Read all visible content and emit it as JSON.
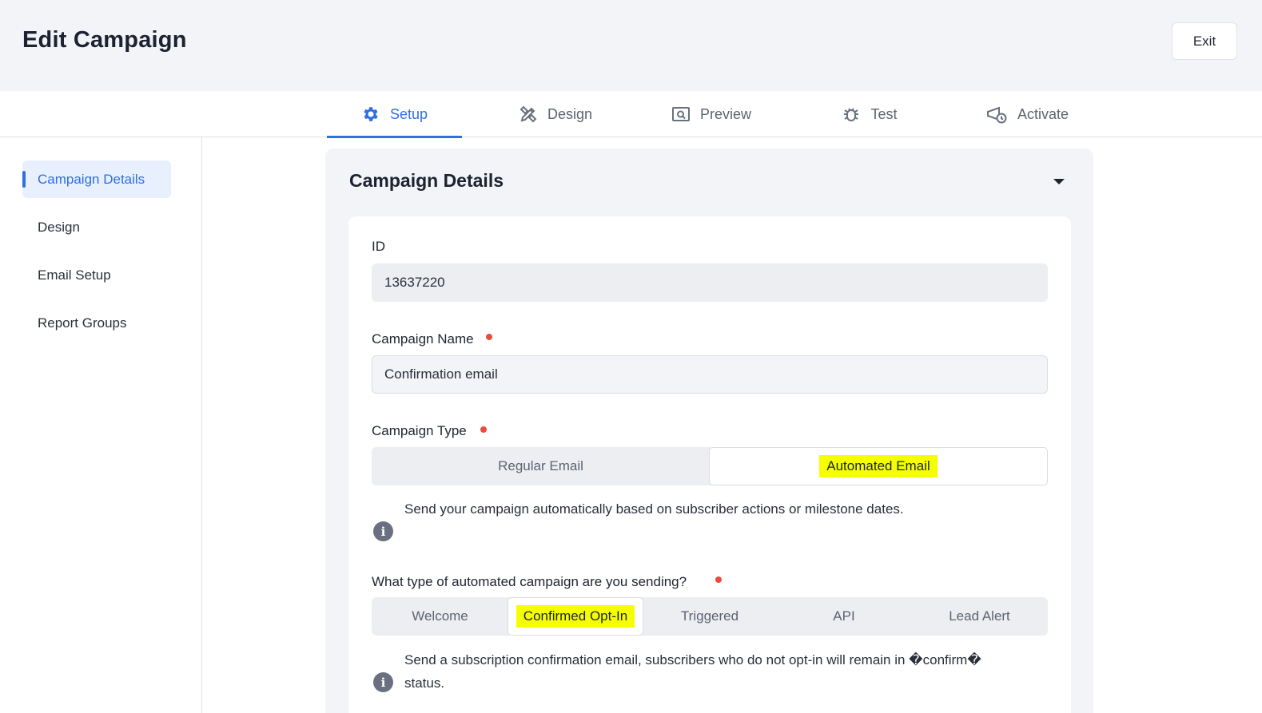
{
  "header": {
    "title": "Edit Campaign",
    "exit_label": "Exit"
  },
  "tabs": [
    {
      "label": "Setup",
      "icon": "gear-icon",
      "active": true
    },
    {
      "label": "Design",
      "icon": "design-tools-icon",
      "active": false
    },
    {
      "label": "Preview",
      "icon": "preview-icon",
      "active": false
    },
    {
      "label": "Test",
      "icon": "bug-icon",
      "active": false
    },
    {
      "label": "Activate",
      "icon": "activate-megaphone-icon",
      "active": false
    }
  ],
  "sidebar": {
    "items": [
      {
        "label": "Campaign Details",
        "active": true
      },
      {
        "label": "Design",
        "active": false
      },
      {
        "label": "Email Setup",
        "active": false
      },
      {
        "label": "Report Groups",
        "active": false
      }
    ]
  },
  "panel": {
    "title": "Campaign Details",
    "id_field": {
      "label": "ID",
      "value": "13637220"
    },
    "name_field": {
      "label": "Campaign Name",
      "value": "Confirmation email"
    },
    "type_field": {
      "label": "Campaign Type",
      "options": [
        "Regular Email",
        "Automated Email"
      ],
      "selected": "Automated Email",
      "info": "Send your campaign automatically based on subscriber actions or milestone dates."
    },
    "auto_type_field": {
      "label": "What type of automated campaign are you sending?",
      "options": [
        "Welcome",
        "Confirmed Opt-In",
        "Triggered",
        "API",
        "Lead Alert"
      ],
      "selected": "Confirmed Opt-In",
      "info_line1": "Send a subscription confirmation email, subscribers who do not opt-in will remain in �confirm�",
      "info_line2": "status."
    }
  },
  "colors": {
    "accent": "#2f6fe0",
    "required": "#ec4b3c",
    "highlight": "#f6ff00"
  }
}
